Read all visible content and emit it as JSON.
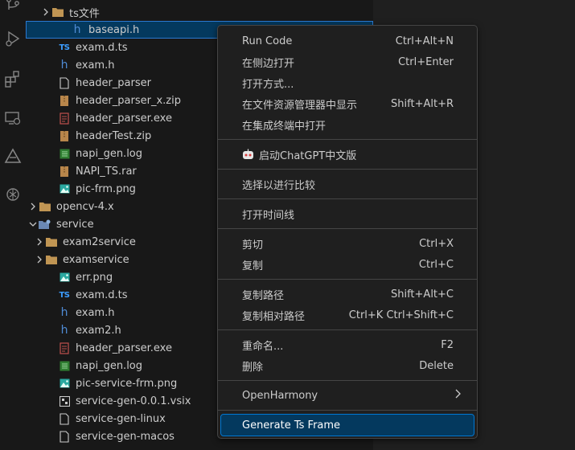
{
  "colors": {
    "sidebar_bg": "#181818",
    "editor_bg": "#1f1f1f",
    "selection": "#04395e",
    "menu_bg": "#1f1f1f",
    "menu_border": "#454545",
    "accent": "#0078d4"
  },
  "activity_bar": {
    "icons": [
      "source-control-icon",
      "run-debug-icon",
      "extensions-icon",
      "remote-explorer-icon",
      "testing-icon",
      "chatgpt-icon"
    ]
  },
  "explorer": {
    "rows": [
      {
        "label": "ts文件",
        "icon": "folder-icon",
        "chevron": "right"
      },
      {
        "label": "baseapi.h",
        "icon": "c-header-icon",
        "selected": true
      },
      {
        "label": "exam.d.ts",
        "icon": "typescript-icon"
      },
      {
        "label": "exam.h",
        "icon": "c-header-icon"
      },
      {
        "label": "header_parser",
        "icon": "file-icon"
      },
      {
        "label": "header_parser_x.zip",
        "icon": "zip-icon"
      },
      {
        "label": "header_parser.exe",
        "icon": "exe-icon"
      },
      {
        "label": "headerTest.zip",
        "icon": "zip-icon"
      },
      {
        "label": "napi_gen.log",
        "icon": "log-icon"
      },
      {
        "label": "NAPI_TS.rar",
        "icon": "zip-icon"
      },
      {
        "label": "pic-frm.png",
        "icon": "image-icon"
      },
      {
        "label": "opencv-4.x",
        "icon": "folder-icon",
        "chevron": "right"
      },
      {
        "label": "service",
        "icon": "service-folder-icon",
        "chevron": "down"
      },
      {
        "label": "exam2service",
        "icon": "folder-icon",
        "chevron": "right"
      },
      {
        "label": "examservice",
        "icon": "folder-icon",
        "chevron": "right"
      },
      {
        "label": "err.png",
        "icon": "image-icon"
      },
      {
        "label": "exam.d.ts",
        "icon": "typescript-icon"
      },
      {
        "label": "exam.h",
        "icon": "c-header-icon"
      },
      {
        "label": "exam2.h",
        "icon": "c-header-icon"
      },
      {
        "label": "header_parser.exe",
        "icon": "exe-icon"
      },
      {
        "label": "napi_gen.log",
        "icon": "log-icon"
      },
      {
        "label": "pic-service-frm.png",
        "icon": "image-icon"
      },
      {
        "label": "service-gen-0.0.1.vsix",
        "icon": "vsix-icon"
      },
      {
        "label": "service-gen-linux",
        "icon": "file-icon"
      },
      {
        "label": "service-gen-macos",
        "icon": "file-icon"
      }
    ]
  },
  "context_menu": {
    "items": [
      {
        "label": "Run Code",
        "shortcut": "Ctrl+Alt+N"
      },
      {
        "label": "在侧边打开",
        "shortcut": "Ctrl+Enter"
      },
      {
        "label": "打开方式...",
        "shortcut": ""
      },
      {
        "label": "在文件资源管理器中显示",
        "shortcut": "Shift+Alt+R"
      },
      {
        "label": "在集成终端中打开",
        "shortcut": ""
      },
      {
        "label": "启动ChatGPT中文版",
        "shortcut": ""
      },
      {
        "label": "选择以进行比较",
        "shortcut": ""
      },
      {
        "label": "打开时间线",
        "shortcut": ""
      },
      {
        "label": "剪切",
        "shortcut": "Ctrl+X"
      },
      {
        "label": "复制",
        "shortcut": "Ctrl+C"
      },
      {
        "label": "复制路径",
        "shortcut": "Shift+Alt+C"
      },
      {
        "label": "复制相对路径",
        "shortcut": "Ctrl+K Ctrl+Shift+C"
      },
      {
        "label": "重命名...",
        "shortcut": "F2"
      },
      {
        "label": "删除",
        "shortcut": "Delete"
      },
      {
        "label": "OpenHarmony",
        "shortcut": ""
      },
      {
        "label": "Generate Ts Frame",
        "shortcut": ""
      }
    ]
  }
}
